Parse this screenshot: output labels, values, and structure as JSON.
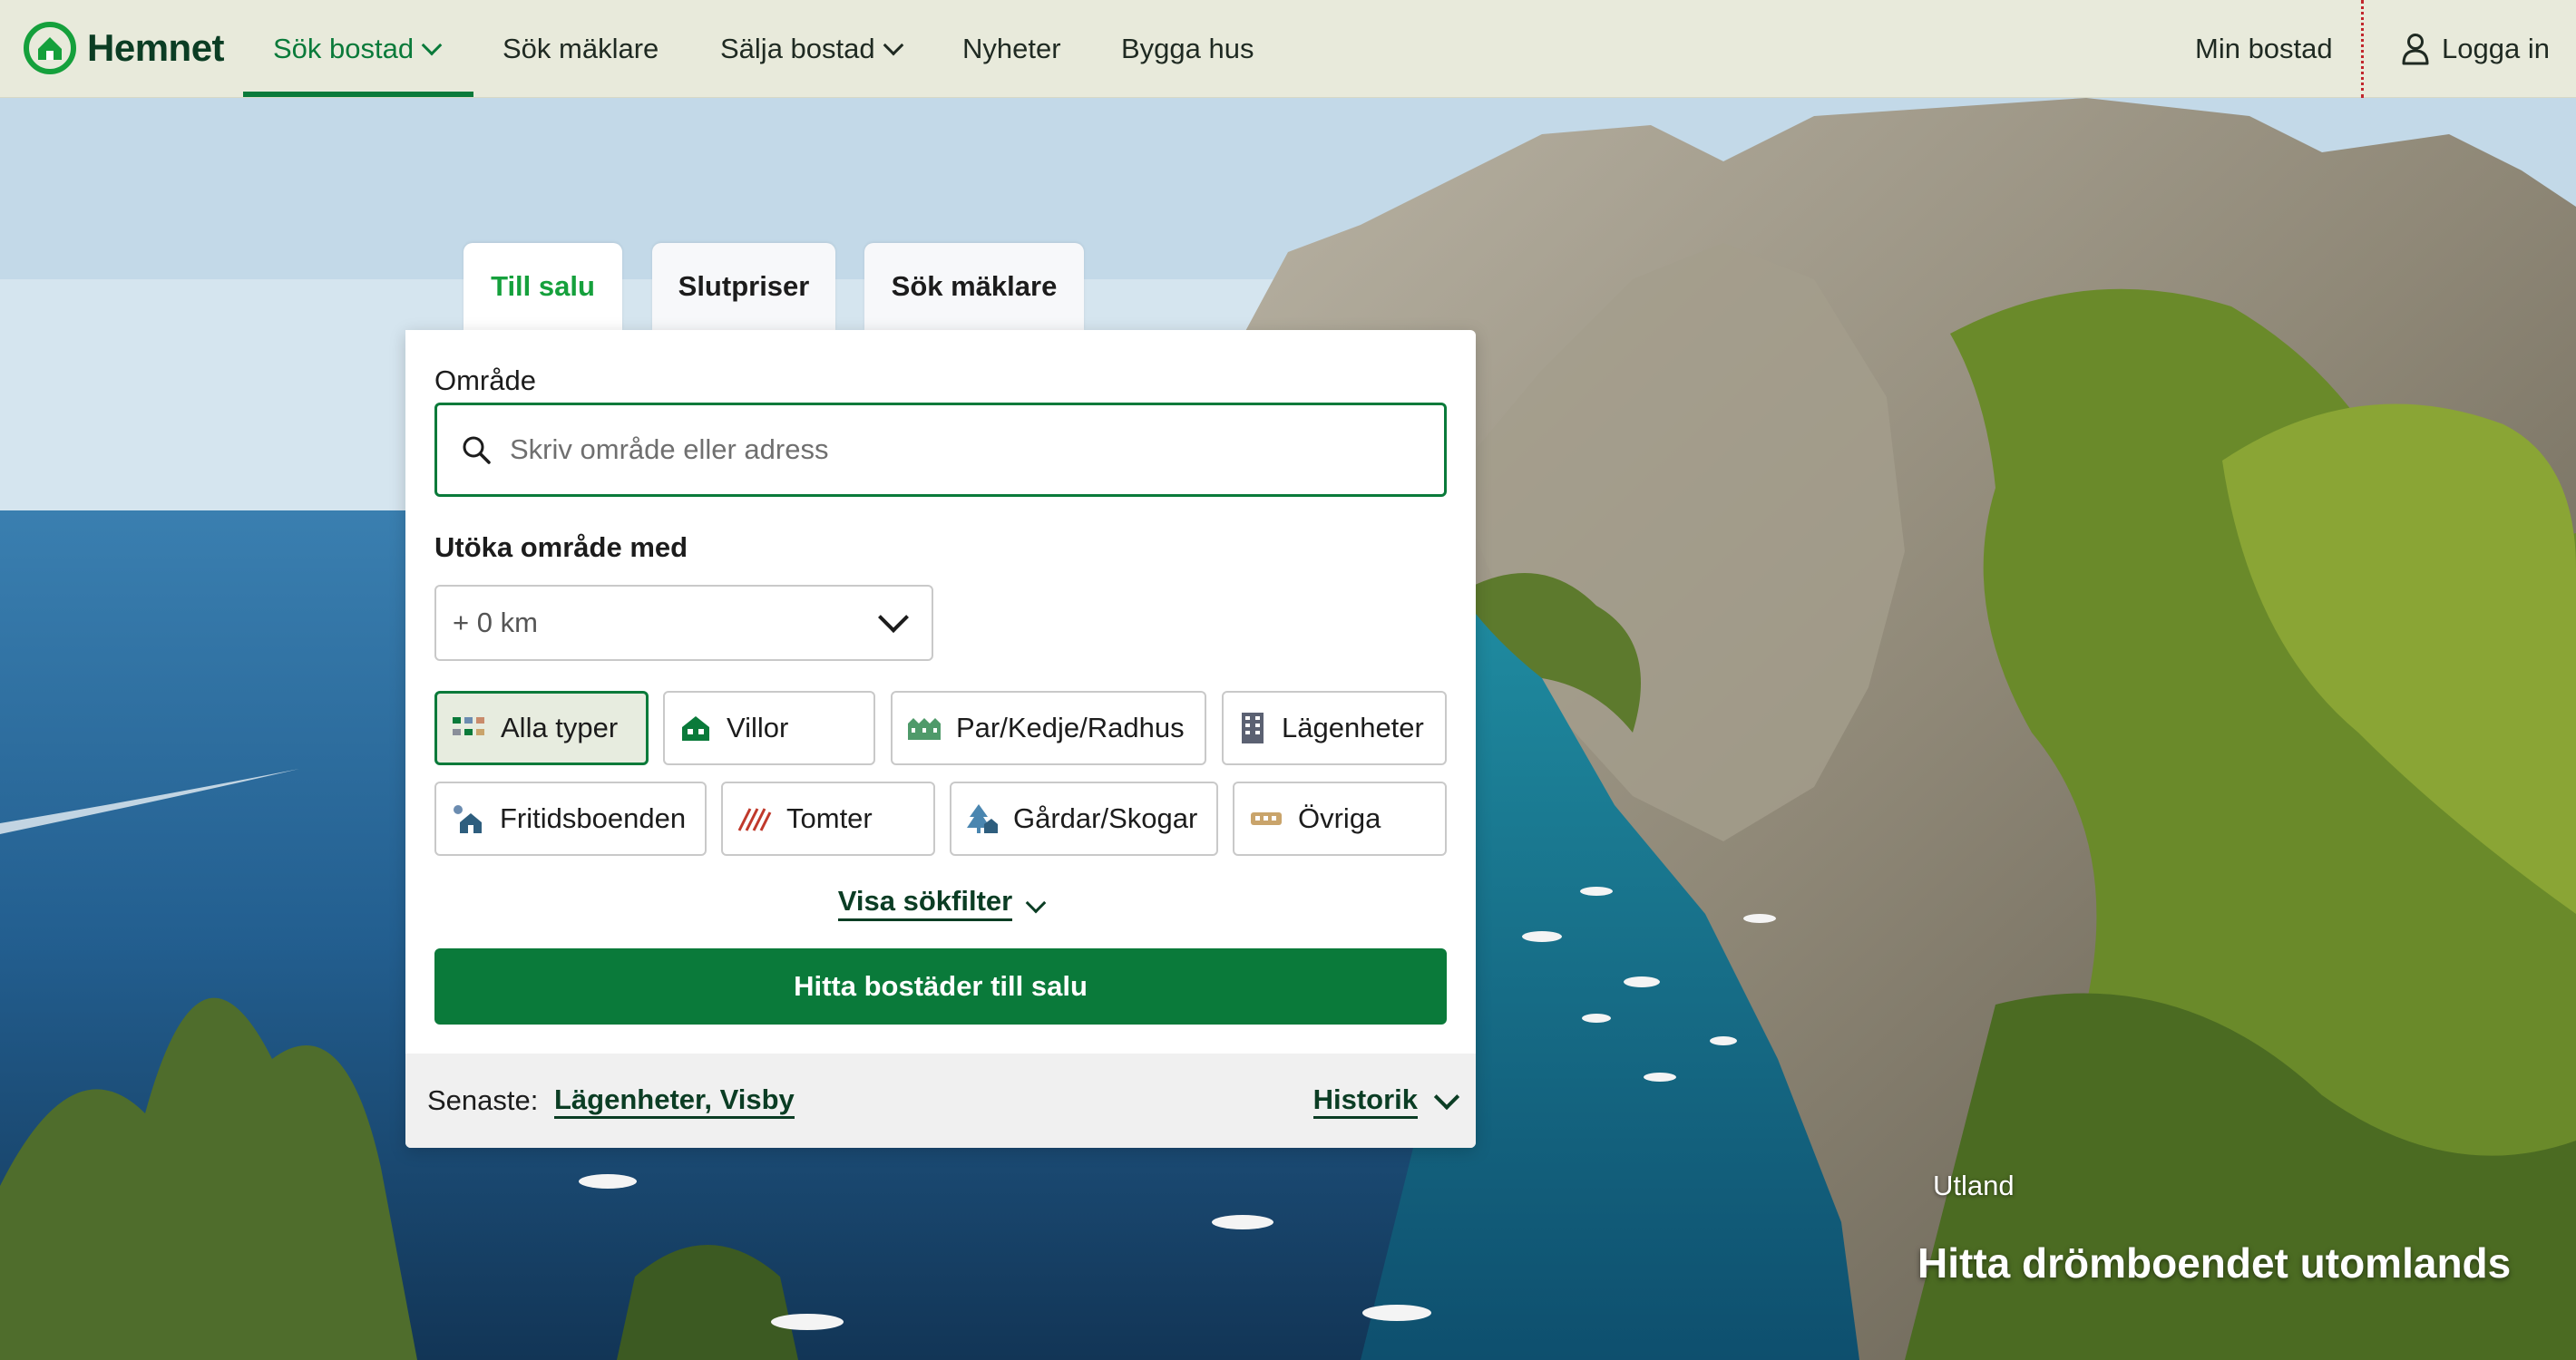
{
  "brand": {
    "name": "Hemnet",
    "color": "#0a7a3a"
  },
  "nav": {
    "items": [
      {
        "label": "Sök bostad",
        "active": true,
        "dropdown": true
      },
      {
        "label": "Sök mäklare"
      },
      {
        "label": "Sälja bostad",
        "dropdown": true
      },
      {
        "label": "Nyheter"
      },
      {
        "label": "Bygga hus"
      }
    ],
    "my_home": "Min bostad",
    "login": "Logga in"
  },
  "search": {
    "tabs": [
      {
        "label": "Till salu",
        "active": true
      },
      {
        "label": "Slutpriser"
      },
      {
        "label": "Sök mäklare"
      }
    ],
    "area_label": "Område",
    "area_placeholder": "Skriv område eller adress",
    "expand_label": "Utöka område med",
    "expand_value": "+ 0 km",
    "types": [
      {
        "label": "Alla typer",
        "icon": "grid-icon",
        "selected": true
      },
      {
        "label": "Villor",
        "icon": "villa-icon"
      },
      {
        "label": "Par/Kedje/Radhus",
        "icon": "townhouse-icon"
      },
      {
        "label": "Lägenheter",
        "icon": "apartment-icon"
      },
      {
        "label": "Fritidsboenden",
        "icon": "cottage-icon"
      },
      {
        "label": "Tomter",
        "icon": "plot-icon"
      },
      {
        "label": "Gårdar/Skogar",
        "icon": "farm-forest-icon"
      },
      {
        "label": "Övriga",
        "icon": "other-icon"
      }
    ],
    "filter_link": "Visa sökfilter",
    "submit": "Hitta bostäder till salu",
    "recent_label": "Senaste:",
    "recent_value": "Lägenheter, Visby",
    "history": "Historik"
  },
  "hero": {
    "kicker": "Utland",
    "headline": "Hitta drömboendet utomlands"
  }
}
